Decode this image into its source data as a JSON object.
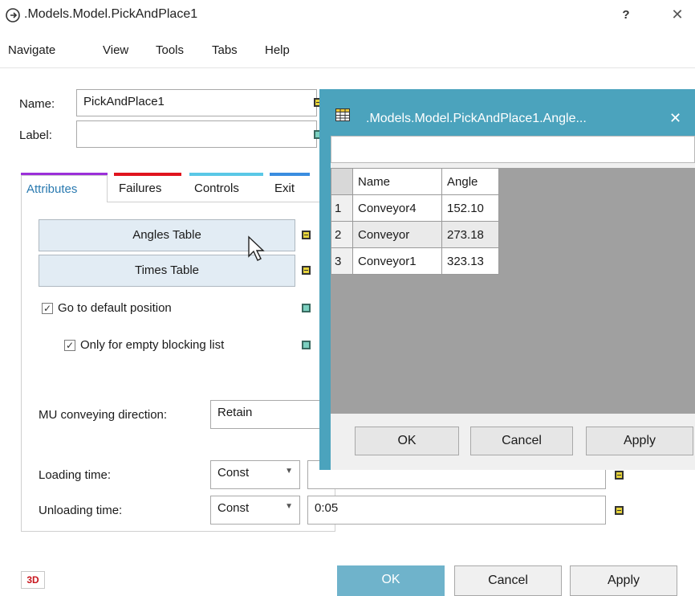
{
  "window": {
    "title": ".Models.Model.PickAndPlace1",
    "help_label": "?",
    "close_label": "✕"
  },
  "menu": [
    "Navigate",
    "View",
    "Tools",
    "Tabs",
    "Help"
  ],
  "form": {
    "name_label": "Name:",
    "name_value": "PickAndPlace1",
    "label_label": "Label:",
    "label_value": ""
  },
  "tabs": [
    {
      "label": "Attributes",
      "color": "#9b30d9",
      "active": true
    },
    {
      "label": "Failures",
      "color": "#e0141e"
    },
    {
      "label": "Controls",
      "color": "#5ac8e6"
    },
    {
      "label": "Exit",
      "color": "#3a8de0"
    }
  ],
  "attributes": {
    "angles_table_button": "Angles Table",
    "times_table_button": "Times Table",
    "go_default_label": "Go to default position",
    "go_default_checked": true,
    "only_empty_label": "Only for empty blocking list",
    "only_empty_checked": true,
    "mu_direction_label": "MU conveying direction:",
    "mu_direction_value": "Retain",
    "loading_label": "Loading time:",
    "loading_type": "Const",
    "unloading_label": "Unloading time:",
    "unloading_type": "Const",
    "unloading_value": "0:05"
  },
  "bottom": {
    "logo": "3D",
    "ok": "OK",
    "cancel": "Cancel",
    "apply": "Apply"
  },
  "table_window": {
    "title": ".Models.Model.PickAndPlace1.Angle...",
    "close_label": "✕",
    "columns": [
      "Name",
      "Angle"
    ],
    "rows": [
      {
        "index": "1",
        "name": "Conveyor4",
        "angle": "152.10"
      },
      {
        "index": "2",
        "name": "Conveyor",
        "angle": "273.18"
      },
      {
        "index": "3",
        "name": "Conveyor1",
        "angle": "323.13"
      }
    ],
    "ok": "OK",
    "cancel": "Cancel",
    "apply": "Apply"
  },
  "colors": {
    "table_window_frame": "#4ba3bd",
    "ok_button": "#6fb3cb"
  }
}
